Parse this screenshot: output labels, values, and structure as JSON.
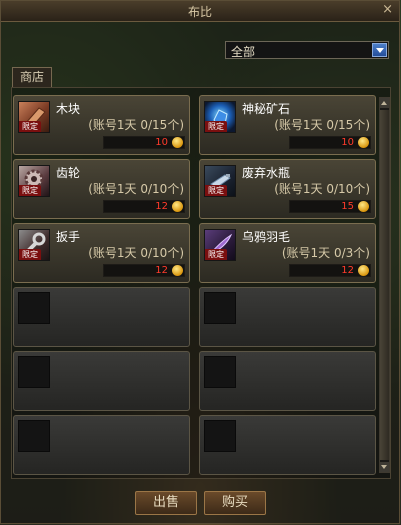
{
  "window": {
    "title": "布比",
    "close_glyph": "×"
  },
  "filter": {
    "selected": "全部"
  },
  "tab": {
    "label": "商店"
  },
  "items": [
    {
      "name": "木块",
      "limit": "(账号1天 0/15个)",
      "price": "10",
      "badge": "限定",
      "icon": "wood-block-icon"
    },
    {
      "name": "神秘矿石",
      "limit": "(账号1天 0/15个)",
      "price": "10",
      "badge": "限定",
      "icon": "mystery-ore-icon"
    },
    {
      "name": "齿轮",
      "limit": "(账号1天 0/10个)",
      "price": "12",
      "badge": "限定",
      "icon": "gear-icon"
    },
    {
      "name": "废弃水瓶",
      "limit": "(账号1天 0/10个)",
      "price": "15",
      "badge": "限定",
      "icon": "water-bottle-icon"
    },
    {
      "name": "扳手",
      "limit": "(账号1天 0/10个)",
      "price": "12",
      "badge": "限定",
      "icon": "wrench-icon"
    },
    {
      "name": "乌鸦羽毛",
      "limit": "(账号1天 0/3个)",
      "price": "12",
      "badge": "限定",
      "icon": "crow-feather-icon"
    }
  ],
  "buttons": {
    "sell": "出售",
    "buy": "购买"
  }
}
